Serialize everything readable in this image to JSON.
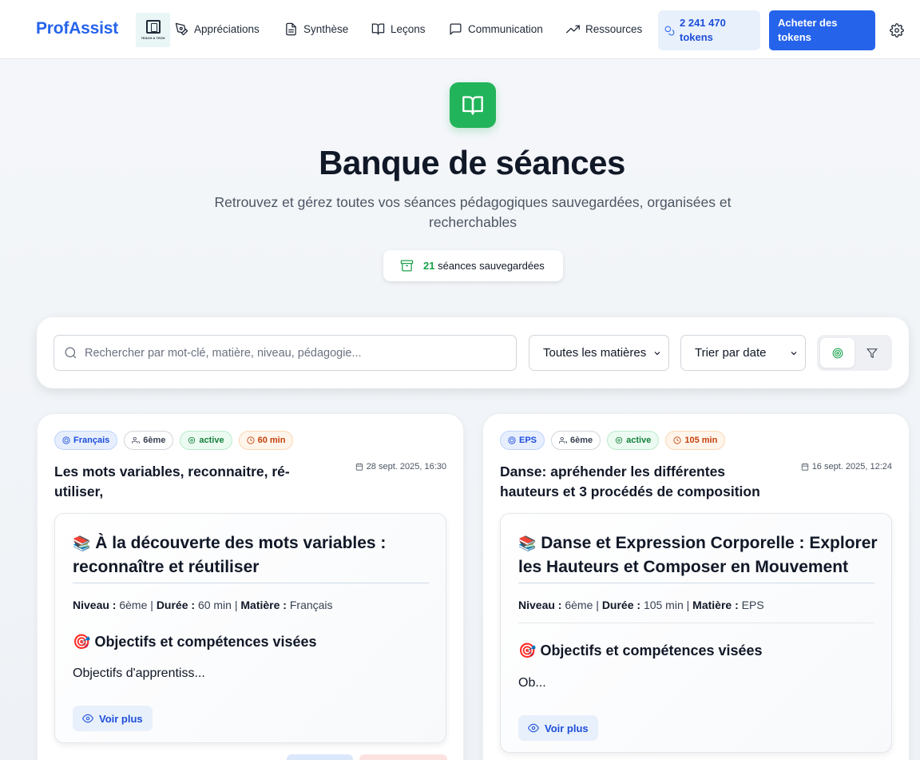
{
  "nav": {
    "brand": "ProfAssist",
    "logo_text": "TEACH & TECH",
    "items": [
      {
        "label": "Appréciations",
        "icon": "pen-icon"
      },
      {
        "label": "Synthèse",
        "icon": "document-icon"
      },
      {
        "label": "Leçons",
        "icon": "book-open-icon"
      },
      {
        "label": "Communication",
        "icon": "message-square-icon"
      },
      {
        "label": "Ressources",
        "icon": "trending-up-icon"
      }
    ],
    "tokens_line1": "2 241 470",
    "tokens_line2": "tokens",
    "buy_line1": "Acheter des",
    "buy_line2": "tokens"
  },
  "hero": {
    "title": "Banque de séances",
    "subtitle": "Retrouvez et gérez toutes vos séances pédagogiques sauvegardées, organisées et recherchables",
    "count": "21",
    "count_label": "séances sauvegardées"
  },
  "filters": {
    "search_placeholder": "Rechercher par mot-clé, matière, niveau, pédagogie...",
    "subject_select": "Toutes les matières",
    "sort_select": "Trier par date"
  },
  "colors": {
    "accent": "#2563eb",
    "green": "#22b45a"
  },
  "cards": [
    {
      "subject": "Français",
      "level": "6ème",
      "status": "active",
      "duration": "60 min",
      "title": "Les mots variables, reconnaitre, ré-utiliser,",
      "date": "28 sept. 2025, 16:30",
      "heading_emoji": "📚",
      "heading": "À la découverte des mots variables : reconnaître et réutiliser",
      "meta_niveau_label": "Niveau :",
      "meta_niveau": "6ème",
      "meta_duree_label": "Durée :",
      "meta_duree": "60 min",
      "meta_matiere_label": "Matière :",
      "meta_matiere": "Français",
      "objectives_emoji": "🎯",
      "objectives_heading": "Objectifs et compétences visées",
      "objectives_text": "Objectifs d'apprentiss...",
      "more_label": "Voir plus"
    },
    {
      "subject": "EPS",
      "level": "6ème",
      "status": "active",
      "duration": "105 min",
      "title": "Danse: apréhender les différentes hauteurs et 3 procédés de composition",
      "date": "16 sept. 2025, 12:24",
      "heading_emoji": "📚",
      "heading": "Danse et Expression Corporelle : Explorer les Hauteurs et Composer en Mouvement",
      "meta_niveau_label": "Niveau :",
      "meta_niveau": "6ème",
      "meta_duree_label": "Durée :",
      "meta_duree": "105 min",
      "meta_matiere_label": "Matière :",
      "meta_matiere": "EPS",
      "objectives_emoji": "🎯",
      "objectives_heading": "Objectifs et compétences visées",
      "objectives_text": "Ob...",
      "more_label": "Voir plus"
    }
  ]
}
